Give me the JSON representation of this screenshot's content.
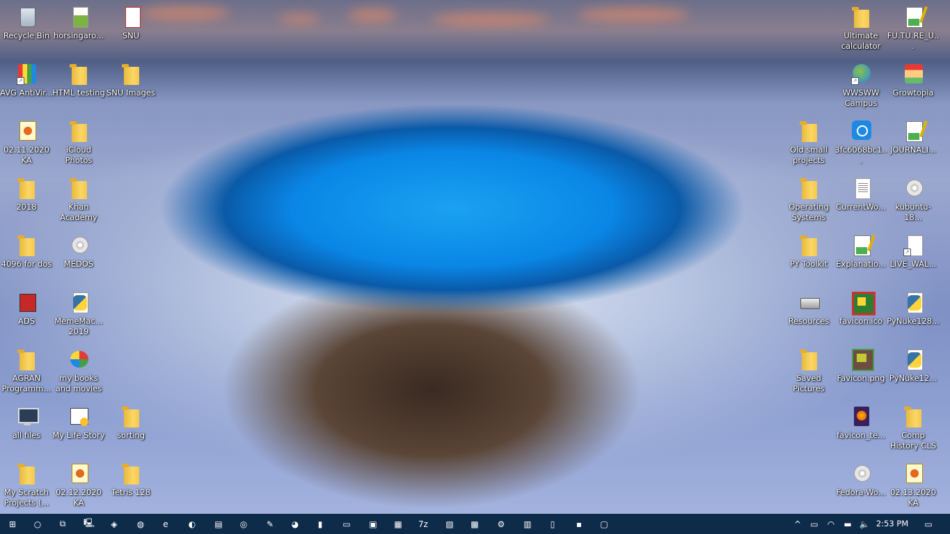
{
  "desktop": {
    "icons": [
      {
        "label": "Recycle Bin",
        "icon": "recycle-bin-icon"
      },
      {
        "label": "horsingaro...",
        "icon": "image-file-icon"
      },
      {
        "label": "SNU",
        "icon": "document-icon"
      },
      {
        "label": "AVG AntiVir...",
        "icon": "avg-antivirus-icon"
      },
      {
        "label": "HTML testing",
        "icon": "folder-icon"
      },
      {
        "label": "SNU Images",
        "icon": "folder-icon"
      },
      {
        "label": "02.11.2020 KA",
        "icon": "paint-file-icon"
      },
      {
        "label": "iCloud Photos",
        "icon": "folder-icon"
      },
      {
        "label": "2018",
        "icon": "folder-icon"
      },
      {
        "label": "Khan Academy",
        "icon": "folder-icon"
      },
      {
        "label": "4096 for dos",
        "icon": "folder-icon"
      },
      {
        "label": "MEDOS",
        "icon": "disc-icon"
      },
      {
        "label": "ADS",
        "icon": "ads-app-icon"
      },
      {
        "label": "MemeMac... 2019",
        "icon": "python-file-icon"
      },
      {
        "label": "AGRAN Programm...",
        "icon": "folder-icon"
      },
      {
        "label": "my books and movies",
        "icon": "windows-media-icon"
      },
      {
        "label": "all files",
        "icon": "monitor-icon"
      },
      {
        "label": "My Life Story",
        "icon": "calendar-app-icon"
      },
      {
        "label": "sorting",
        "icon": "folder-icon"
      },
      {
        "label": "My Scratch Projects (...",
        "icon": "folder-icon"
      },
      {
        "label": "02.12.2020 KA",
        "icon": "paint-file-icon"
      },
      {
        "label": "Tetris 128",
        "icon": "folder-icon"
      },
      {
        "label": "Ultimate calculator",
        "icon": "folder-icon"
      },
      {
        "label": "FU.TU.RE_U...",
        "icon": "notepad-plus-plus-file-icon"
      },
      {
        "label": "WWSWW Campus",
        "icon": "globe-mouse-icon"
      },
      {
        "label": "Growtopia",
        "icon": "growtopia-icon"
      },
      {
        "label": "Old small projects",
        "icon": "folder-icon"
      },
      {
        "label": "3fc6068bc1...",
        "icon": "instagram-icon"
      },
      {
        "label": "JOURNALI...",
        "icon": "notepad-plus-plus-file-icon"
      },
      {
        "label": "Operating Systems",
        "icon": "folder-icon"
      },
      {
        "label": "CurrentWo...",
        "icon": "text-document-icon"
      },
      {
        "label": "kubuntu-18...",
        "icon": "disc-image-icon"
      },
      {
        "label": "PY Toolkit",
        "icon": "folder-icon"
      },
      {
        "label": "Explanatio...",
        "icon": "notepad-plus-plus-file-icon"
      },
      {
        "label": "LIVE_WAL...",
        "icon": "shortcut-file-icon"
      },
      {
        "label": "Resources",
        "icon": "drive-icon"
      },
      {
        "label": "favicon.ico",
        "icon": "favicon-icon"
      },
      {
        "label": "PyNuke128...",
        "icon": "python-file-icon"
      },
      {
        "label": "Saved Pictures",
        "icon": "folder-icon"
      },
      {
        "label": "Favicon.png",
        "icon": "favicon-png-icon"
      },
      {
        "label": "PyNuke12...",
        "icon": "python-file-icon"
      },
      {
        "label": "favicon_te...",
        "icon": "firefox-file-icon"
      },
      {
        "label": "Comp History CLS",
        "icon": "folder-icon"
      },
      {
        "label": "Fedora-Wo...",
        "icon": "disc-image-icon"
      },
      {
        "label": "02.13.2020 KA",
        "icon": "paint-file-icon"
      }
    ]
  },
  "taskbar": {
    "items": [
      {
        "icon": "windows-start-icon",
        "glyph": "⊞"
      },
      {
        "icon": "cortana-search-icon",
        "glyph": "○"
      },
      {
        "icon": "task-view-icon",
        "glyph": "⧉"
      },
      {
        "icon": "this-pc-icon",
        "glyph": "🖳"
      },
      {
        "icon": "code-editor-icon",
        "glyph": "◈"
      },
      {
        "icon": "app-icon",
        "glyph": "◍"
      },
      {
        "icon": "edge-browser-icon",
        "glyph": "e"
      },
      {
        "icon": "firefox-icon",
        "glyph": "◐"
      },
      {
        "icon": "notepad-icon",
        "glyph": "▤"
      },
      {
        "icon": "xbox-icon",
        "glyph": "◎"
      },
      {
        "icon": "paint-icon",
        "glyph": "✎"
      },
      {
        "icon": "gimp-icon",
        "glyph": "◕"
      },
      {
        "icon": "usb-tool-icon",
        "glyph": "▮"
      },
      {
        "icon": "file-explorer-icon",
        "glyph": "▭"
      },
      {
        "icon": "photos-icon",
        "glyph": "▣"
      },
      {
        "icon": "file-manager-icon",
        "glyph": "▦"
      },
      {
        "icon": "7zip-icon",
        "glyph": "7z"
      },
      {
        "icon": "paint-3d-icon",
        "glyph": "▨"
      },
      {
        "icon": "office-icon",
        "glyph": "▩"
      },
      {
        "icon": "settings-gear-icon",
        "glyph": "⚙"
      },
      {
        "icon": "store-icon",
        "glyph": "▥"
      },
      {
        "icon": "film-icon",
        "glyph": "▯"
      },
      {
        "icon": "sticky-notes-icon",
        "glyph": "▪"
      },
      {
        "icon": "remote-desktop-icon",
        "glyph": "▢"
      }
    ],
    "tray": [
      {
        "icon": "chevron-up-icon",
        "glyph": "^"
      },
      {
        "icon": "tablet-icon",
        "glyph": "▭"
      },
      {
        "icon": "wifi-icon",
        "glyph": "◠"
      },
      {
        "icon": "battery-icon",
        "glyph": "▬"
      },
      {
        "icon": "volume-icon",
        "glyph": "🔈"
      }
    ],
    "clock": "2:53 PM",
    "notifications_icon": "action-center-icon"
  },
  "colors": {
    "taskbar": "#0f2b4a",
    "pool": "#0a86e6"
  }
}
